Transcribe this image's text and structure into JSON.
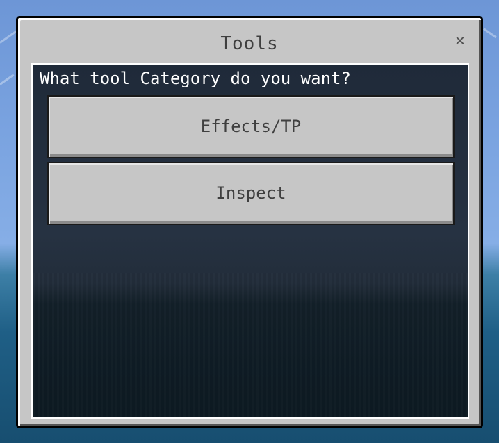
{
  "dialog": {
    "title": "Tools",
    "close_label": "×",
    "prompt": "What tool Category do you want?",
    "buttons": [
      {
        "label": "Effects/TP"
      },
      {
        "label": "Inspect"
      }
    ]
  }
}
